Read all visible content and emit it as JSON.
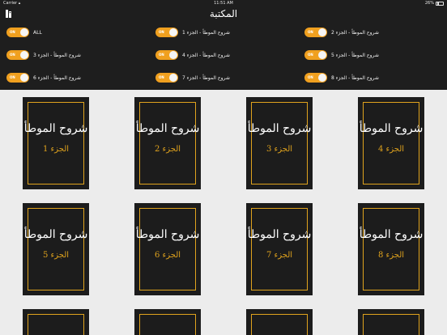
{
  "status": {
    "carrier": "Carrier",
    "time": "11:51 AM",
    "battery": "26%",
    "battery_level": 0.26
  },
  "nav": {
    "title": "المكتبة"
  },
  "toggles": [
    {
      "label": "ALL",
      "state": "ON"
    },
    {
      "label": "شروح الموطأ - الجزء 1",
      "state": "ON"
    },
    {
      "label": "شروح الموطأ - الجزء 2",
      "state": "ON"
    },
    {
      "label": "شروح الموطأ - الجزء 3",
      "state": "ON"
    },
    {
      "label": "شروح الموطأ - الجزء 4",
      "state": "ON"
    },
    {
      "label": "شروح الموطأ - الجزء 5",
      "state": "ON"
    },
    {
      "label": "شروح الموطأ - الجزء 6",
      "state": "ON"
    },
    {
      "label": "شروح الموطأ - الجزء 7",
      "state": "ON"
    },
    {
      "label": "شروح الموطأ - الجزء 8",
      "state": "ON"
    }
  ],
  "books": [
    {
      "title": "شروح الموطأ",
      "part": "الجزء 1"
    },
    {
      "title": "شروح الموطأ",
      "part": "الجزء 2"
    },
    {
      "title": "شروح الموطأ",
      "part": "الجزء 3"
    },
    {
      "title": "شروح الموطأ",
      "part": "الجزء 4"
    },
    {
      "title": "شروح الموطأ",
      "part": "الجزء 5"
    },
    {
      "title": "شروح الموطأ",
      "part": "الجزء 6"
    },
    {
      "title": "شروح الموطأ",
      "part": "الجزء 7"
    },
    {
      "title": "شروح الموطأ",
      "part": "الجزء 8"
    }
  ],
  "colors": {
    "accent": "#e0a31d",
    "header_bg": "#1e1e1e",
    "content_bg": "#ececec"
  }
}
